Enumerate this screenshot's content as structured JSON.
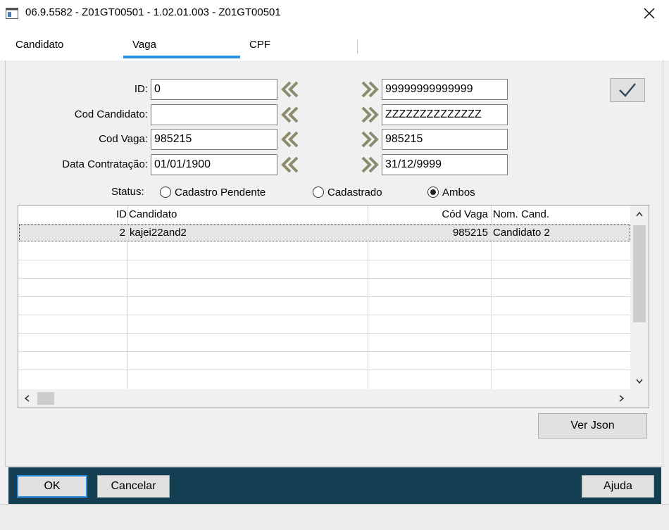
{
  "window": {
    "title": "06.9.5582 - Z01GT00501 - 1.02.01.003 - Z01GT00501",
    "app_icon": "window-app-icon",
    "close_icon": "close-icon"
  },
  "tabs": [
    {
      "label": "Candidato",
      "active": false
    },
    {
      "label": "Vaga",
      "active": true
    },
    {
      "label": "CPF",
      "active": false
    }
  ],
  "accent_color": "#2b8fe0",
  "filters": [
    {
      "label": "ID:",
      "from": "0",
      "to": "99999999999999"
    },
    {
      "label": "Cod Candidato:",
      "from": "",
      "to": "ZZZZZZZZZZZZZZ"
    },
    {
      "label": "Cod Vaga:",
      "from": "985215",
      "to": "985215"
    },
    {
      "label": "Data Contratação:",
      "from": "01/01/1900",
      "to": "31/12/9999"
    }
  ],
  "status": {
    "label": "Status:",
    "options": [
      {
        "label": "Cadastro Pendente",
        "checked": false
      },
      {
        "label": "Cadastrado",
        "checked": false
      },
      {
        "label": "Ambos",
        "checked": true
      }
    ]
  },
  "grid": {
    "columns": [
      "ID",
      "Candidato",
      "Cód Vaga",
      "Nom. Cand."
    ],
    "rows": [
      [
        "2",
        "kajei22and2",
        "985215",
        "Candidato 2"
      ]
    ]
  },
  "buttons": {
    "ver_json": "Ver Json",
    "ok": "OK",
    "cancelar": "Cancelar",
    "ajuda": "Ajuda"
  },
  "footer_color": "#143e52"
}
